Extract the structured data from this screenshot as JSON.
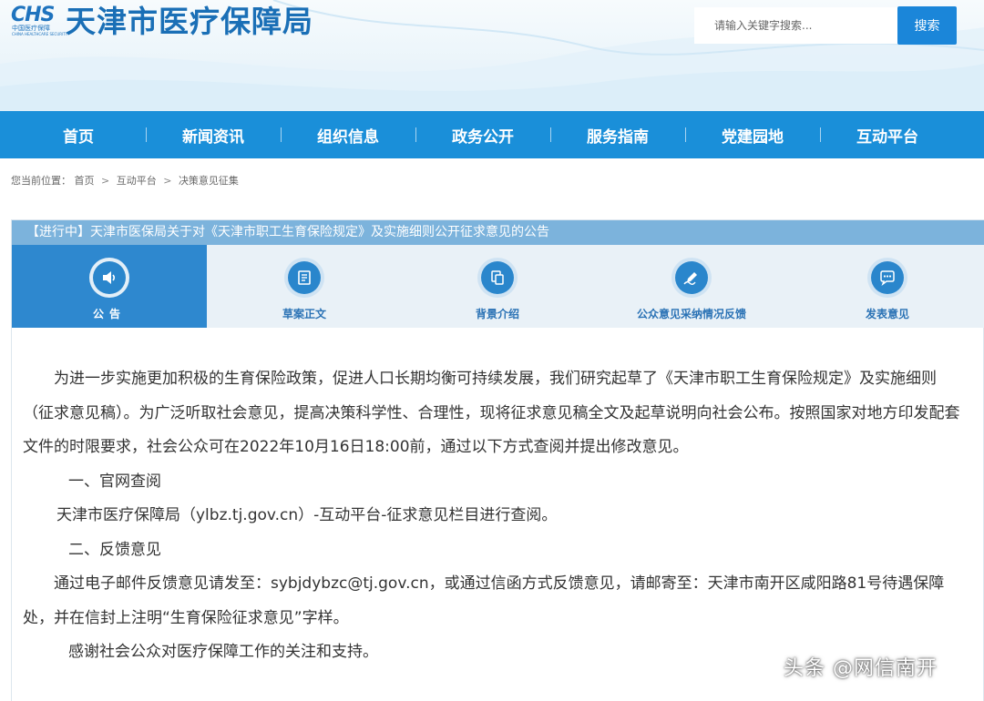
{
  "header": {
    "logo_abbr": "CHS",
    "logo_cn": "中国医疗保障",
    "logo_en": "CHINA HEALTHCARE SECURITY",
    "site_title": "天津市医疗保障局",
    "search_placeholder": "请输入关键字搜索...",
    "search_button": "搜索"
  },
  "nav": {
    "items": [
      "首页",
      "新闻资讯",
      "组织信息",
      "政务公开",
      "服务指南",
      "党建园地",
      "互动平台"
    ]
  },
  "breadcrumb": {
    "prefix": "您当前位置：",
    "items": [
      "首页",
      "互动平台",
      "决策意见征集"
    ],
    "separator": ">"
  },
  "panel": {
    "title": "【进行中】天津市医保局关于对《天津市职工生育保险规定》及实施细则公开征求意见的公告",
    "tabs": [
      {
        "label": "公告",
        "icon": "speaker-icon",
        "active": true
      },
      {
        "label": "草案正文",
        "icon": "document-icon",
        "active": false
      },
      {
        "label": "背景介绍",
        "icon": "copy-icon",
        "active": false
      },
      {
        "label": "公众意见采纳情况反馈",
        "icon": "pen-icon",
        "active": false
      },
      {
        "label": "发表意见",
        "icon": "chat-icon",
        "active": false
      }
    ]
  },
  "content": {
    "para1": "为进一步实施更加积极的生育保险政策，促进人口长期均衡可持续发展，我们研究起草了《天津市职工生育保险规定》及实施细则（征求意见稿）。为广泛听取社会意见，提高决策科学性、合理性，现将征求意见稿全文及起草说明向社会公布。按照国家对地方印发配套文件的时限要求，社会公众可在2022年10月16日18:00前，通过以下方式查阅并提出修改意见。",
    "heading1": "一、官网查阅",
    "para2": "天津市医疗保障局（ylbz.tj.gov.cn）-互动平台-征求意见栏目进行查阅。",
    "heading2": "二、反馈意见",
    "para3": "通过电子邮件反馈意见请发至：sybjdybzc@tj.gov.cn，或通过信函方式反馈意见，请邮寄至：天津市南开区咸阳路81号待遇保障处，并在信封上注明“生育保险征求意见”字样。",
    "para4": "感谢社会公众对医疗保障工作的关注和支持。"
  },
  "watermark": "头条 @网信南开",
  "colors": {
    "nav_bg": "#1a8fd9",
    "title_bar": "#7cb3dc",
    "tab_active": "#2e88cf",
    "tab_bg": "#e9f1f7",
    "search_button": "#1b86d9",
    "site_title": "#1a6fb6"
  }
}
